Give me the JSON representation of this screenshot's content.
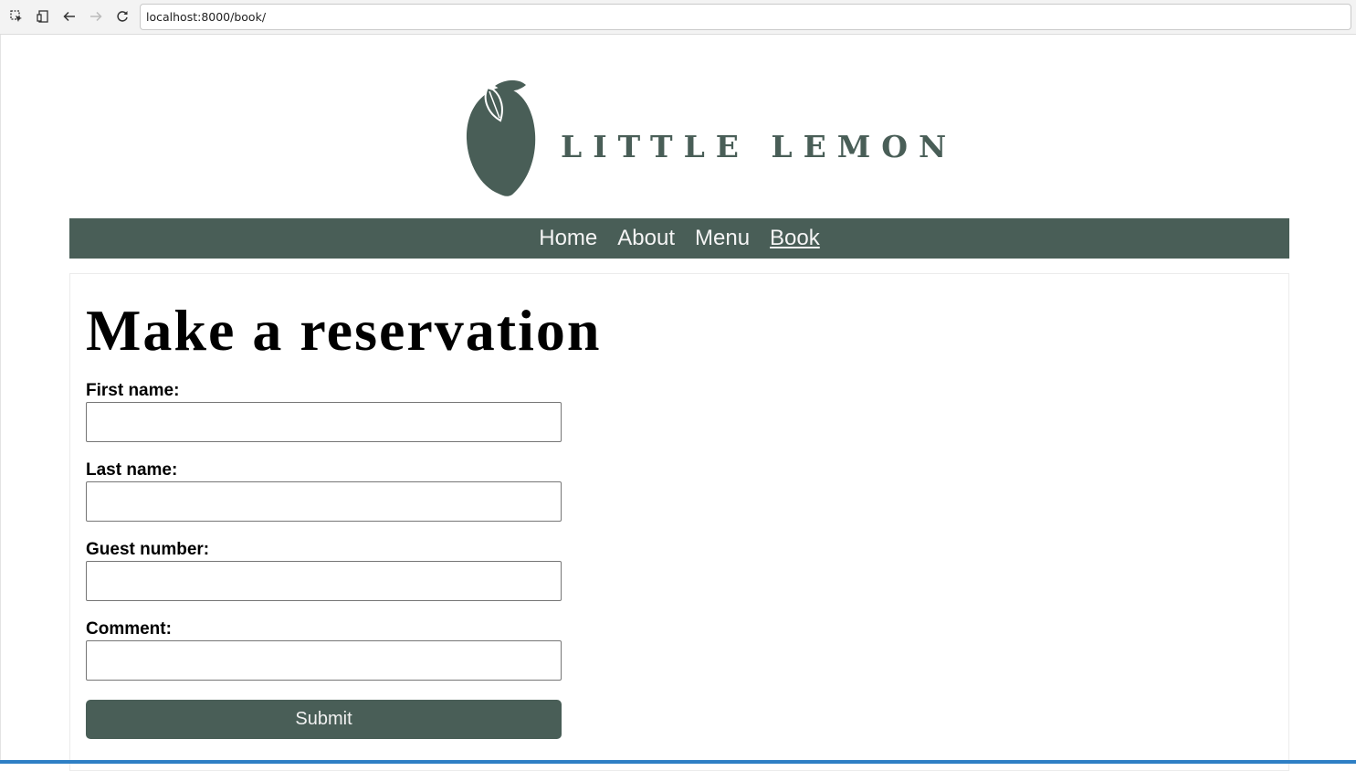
{
  "browser": {
    "url": "localhost:8000/book/",
    "icons": [
      "inspect-icon",
      "device-toggle-icon",
      "back-arrow-icon",
      "forward-arrow-icon",
      "reload-icon"
    ]
  },
  "brand": {
    "logo_text": "LITTLE LEMON",
    "brand_color": "#495e57"
  },
  "nav": {
    "items": [
      {
        "label": "Home",
        "active": false
      },
      {
        "label": "About",
        "active": false
      },
      {
        "label": "Menu",
        "active": false
      },
      {
        "label": "Book",
        "active": true
      }
    ]
  },
  "form": {
    "title": "Make a reservation",
    "fields": [
      {
        "label": "First name:",
        "value": ""
      },
      {
        "label": "Last name:",
        "value": ""
      },
      {
        "label": "Guest number:",
        "value": ""
      },
      {
        "label": "Comment:",
        "value": ""
      }
    ],
    "submit_label": "Submit"
  }
}
